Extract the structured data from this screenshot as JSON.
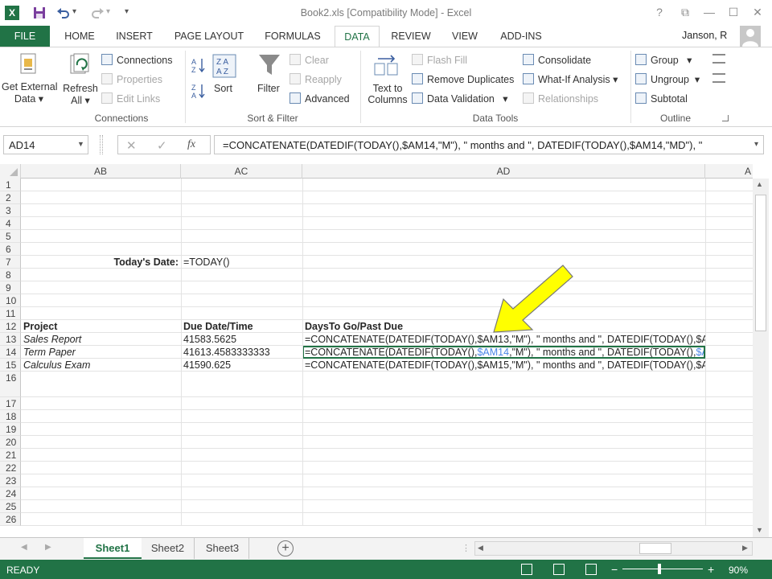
{
  "window": {
    "title": "Book2.xls  [Compatibility Mode] - Excel",
    "help": "?",
    "minimize": "—",
    "maximize": "☐",
    "close": "✕",
    "restore": "⧉"
  },
  "qat": {
    "excel_icon": "X",
    "undo_caret": "▾",
    "redo_caret": "▾",
    "customize": "▾"
  },
  "tabs": [
    "HOME",
    "INSERT",
    "PAGE LAYOUT",
    "FORMULAS",
    "DATA",
    "REVIEW",
    "VIEW",
    "ADD-INS"
  ],
  "file_tab": "FILE",
  "user": "Janson, R",
  "ribbon": {
    "get_external": {
      "line1": "Get External",
      "line2": "Data"
    },
    "refresh": {
      "line1": "Refresh",
      "line2": "All"
    },
    "connections": "Connections",
    "properties": "Properties",
    "edit_links": "Edit Links",
    "connections_label": "Connections",
    "sort": "Sort",
    "filter": "Filter",
    "clear": "Clear",
    "reapply": "Reapply",
    "advanced": "Advanced",
    "sort_filter_label": "Sort & Filter",
    "text_to_columns": {
      "line1": "Text to",
      "line2": "Columns"
    },
    "flash_fill": "Flash Fill",
    "remove_duplicates": "Remove Duplicates",
    "data_validation": "Data Validation",
    "consolidate": "Consolidate",
    "what_if": "What-If Analysis",
    "relationships": "Relationships",
    "data_tools_label": "Data Tools",
    "group": "Group",
    "ungroup": "Ungroup",
    "subtotal": "Subtotal",
    "outline_label": "Outline"
  },
  "formula_bar": {
    "name_box": "AD14",
    "cancel": "✕",
    "enter": "✓",
    "fx": "fx",
    "formula": "=CONCATENATE(DATEDIF(TODAY(),$AM14,\"M\"), \" months and \", DATEDIF(TODAY(),$AM14,\"MD\"),  \""
  },
  "columns": [
    "AB",
    "AC",
    "AD"
  ],
  "rows": [
    "1",
    "2",
    "3",
    "4",
    "5",
    "6",
    "7",
    "8",
    "9",
    "10",
    "11",
    "12",
    "13",
    "14",
    "15",
    "16",
    "17",
    "18",
    "19",
    "20",
    "21",
    "22",
    "23",
    "24",
    "25",
    "26"
  ],
  "cells": {
    "today_label": "Today's Date:",
    "today_formula": "=TODAY()",
    "hdr_project": "Project",
    "hdr_due": "Due Date/Time",
    "hdr_days": "DaysTo Go/Past Due",
    "r13": {
      "project": "Sales Report",
      "due": "41583.5625",
      "formula": "=CONCATENATE(DATEDIF(TODAY(),$AM13,\"M\"), \" months and \", DATEDIF(TODAY(),$A"
    },
    "r14": {
      "project": "Term Paper",
      "due": "41613.4583333333",
      "f_pre": "=CONCATENATE(DATEDIF(TODAY(),",
      "f_ref": "$AM14",
      "f_post": ",\"M\"), \" months and \", DATEDIF(TODAY(),",
      "f_ref2": "$A"
    },
    "r15": {
      "project": "Calculus Exam",
      "due": "41590.625",
      "formula": "=CONCATENATE(DATEDIF(TODAY(),$AM15,\"M\"), \" months and \", DATEDIF(TODAY(),$A"
    }
  },
  "sheets": [
    "Sheet1",
    "Sheet2",
    "Sheet3"
  ],
  "add_sheet": "+",
  "status": {
    "ready": "READY",
    "zoom": "90%",
    "zoom_minus": "−",
    "zoom_plus": "+"
  },
  "colors": {
    "excel_green": "#217346",
    "arrow_yellow": "#ffff00",
    "ref_blue": "#4a86e8"
  }
}
